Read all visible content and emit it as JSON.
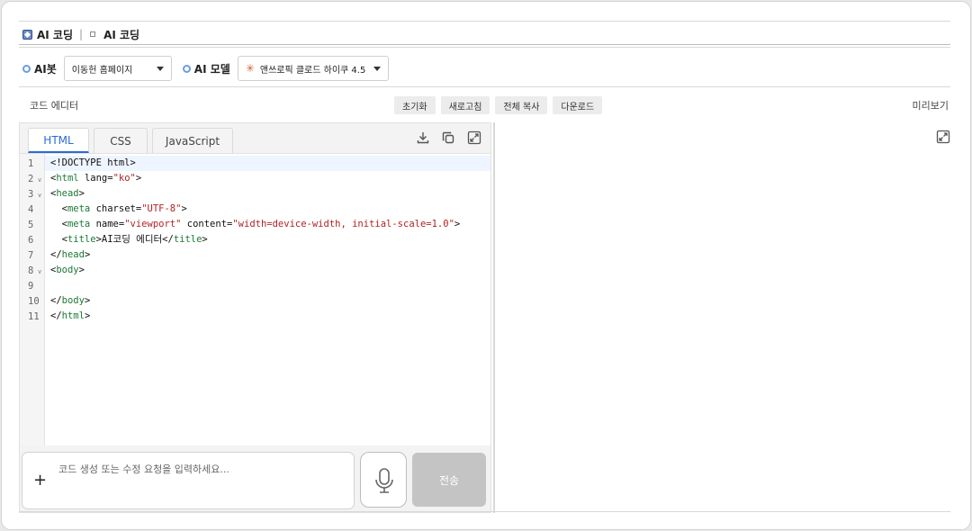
{
  "header": {
    "app_title": "AI 코딩",
    "breadcrumb": "AI 코딩"
  },
  "bot": {
    "label": "AI봇",
    "selected": "이동헌 홈페이지"
  },
  "model": {
    "label": "AI 모델",
    "selected": "앤쓰로픽 클로드 하이쿠 4.5"
  },
  "toolbar": {
    "editor_label": "코드 에디터",
    "preview_label": "미리보기",
    "buttons": [
      "초기화",
      "새로고침",
      "전체 복사",
      "다운로드"
    ]
  },
  "tabs": [
    "HTML",
    "CSS",
    "JavaScript"
  ],
  "active_tab": "HTML",
  "code": {
    "line_numbers": [
      "1",
      "2",
      "3",
      "4",
      "5",
      "6",
      "7",
      "8",
      "9",
      "10",
      "11"
    ],
    "fold_markers": [
      "2",
      "3",
      "8"
    ]
  },
  "chat": {
    "placeholder": "코드 생성 또는 수정 요청을 입력하세요...",
    "plus": "+",
    "send_label": "전송"
  },
  "icons": [
    "app-icon",
    "page-icon",
    "download-icon",
    "copy-icon",
    "expand-icon",
    "microphone-icon",
    "sparkle-icon"
  ],
  "colors": {
    "accent": "#2a6bd8",
    "radio": "#6d9ce0",
    "send_disabled": "#c4c4c4",
    "model_spark": "#d8603a"
  }
}
